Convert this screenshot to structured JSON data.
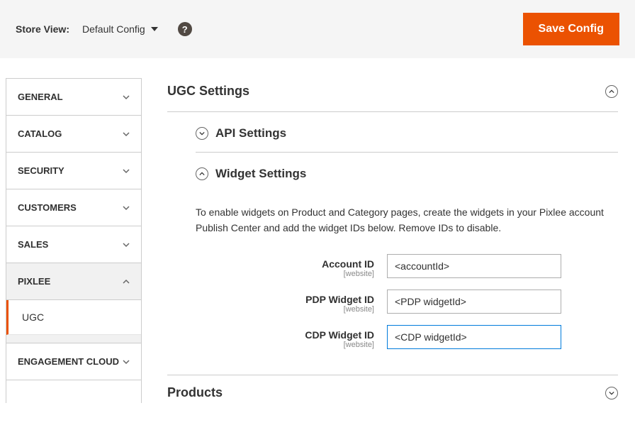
{
  "topbar": {
    "store_view_label": "Store View:",
    "store_view_value": "Default Config",
    "save_button": "Save Config"
  },
  "sidebar": {
    "items": [
      {
        "label": "GENERAL",
        "expanded": false
      },
      {
        "label": "CATALOG",
        "expanded": false
      },
      {
        "label": "SECURITY",
        "expanded": false
      },
      {
        "label": "CUSTOMERS",
        "expanded": false
      },
      {
        "label": "SALES",
        "expanded": false
      },
      {
        "label": "PIXLEE",
        "expanded": true
      },
      {
        "label": "ENGAGEMENT CLOUD",
        "expanded": false
      }
    ],
    "pixlee_sub": "UGC"
  },
  "main": {
    "ugc_title": "UGC Settings",
    "api_settings_title": "API Settings",
    "widget_settings_title": "Widget Settings",
    "widget_help": "To enable widgets on Product and Category pages, create the widgets in your Pixlee account Publish Center and add the widget IDs below. Remove IDs to disable.",
    "fields": {
      "account_id": {
        "label": "Account ID",
        "scope": "[website]",
        "value": "<accountId>"
      },
      "pdp_widget_id": {
        "label": "PDP Widget ID",
        "scope": "[website]",
        "value": "<PDP widgetId>"
      },
      "cdp_widget_id": {
        "label": "CDP Widget ID",
        "scope": "[website]",
        "value": "<CDP widgetId>"
      }
    },
    "products_title": "Products"
  }
}
